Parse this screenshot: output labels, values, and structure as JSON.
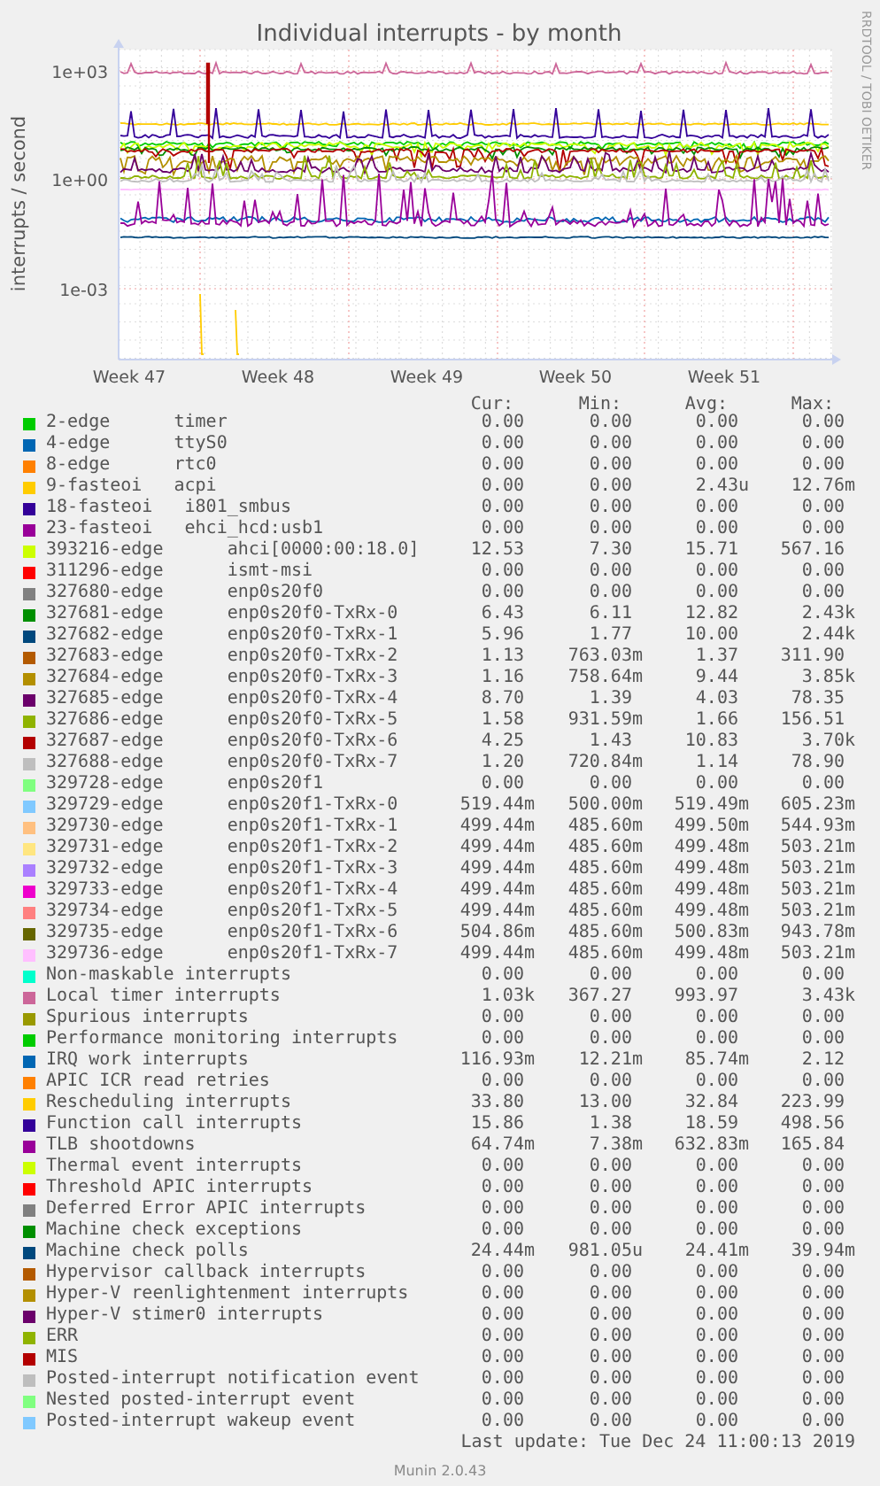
{
  "graph": {
    "title": "Individual interrupts - by month",
    "y_axis_label": "interrupts / second",
    "credit": "RRDTOOL / TOBI OETIKER",
    "y_ticks": [
      "1e+03",
      "1e+00",
      "1e-03"
    ],
    "x_ticks": [
      "Week 47",
      "Week 48",
      "Week 49",
      "Week 50",
      "Week 51"
    ]
  },
  "legend": {
    "columns": [
      "Cur:",
      "Min:",
      "Avg:",
      "Max:"
    ],
    "rows": [
      {
        "label": "2-edge      timer",
        "color": "#00cc00",
        "cur": "0.00",
        "min": "0.00",
        "avg": "0.00",
        "max": "0.00"
      },
      {
        "label": "4-edge      ttyS0",
        "color": "#0066b3",
        "cur": "0.00",
        "min": "0.00",
        "avg": "0.00",
        "max": "0.00"
      },
      {
        "label": "8-edge      rtc0",
        "color": "#ff8000",
        "cur": "0.00",
        "min": "0.00",
        "avg": "0.00",
        "max": "0.00"
      },
      {
        "label": "9-fasteoi   acpi",
        "color": "#ffcc00",
        "cur": "0.00",
        "min": "0.00",
        "avg": "2.43u",
        "max": "12.76m"
      },
      {
        "label": "18-fasteoi   i801_smbus",
        "color": "#330099",
        "cur": "0.00",
        "min": "0.00",
        "avg": "0.00",
        "max": "0.00"
      },
      {
        "label": "23-fasteoi   ehci_hcd:usb1",
        "color": "#990099",
        "cur": "0.00",
        "min": "0.00",
        "avg": "0.00",
        "max": "0.00"
      },
      {
        "label": "393216-edge      ahci[0000:00:18.0]",
        "color": "#ccff00",
        "cur": "12.53",
        "min": "7.30",
        "avg": "15.71",
        "max": "567.16"
      },
      {
        "label": "311296-edge      ismt-msi",
        "color": "#ff0000",
        "cur": "0.00",
        "min": "0.00",
        "avg": "0.00",
        "max": "0.00"
      },
      {
        "label": "327680-edge      enp0s20f0",
        "color": "#808080",
        "cur": "0.00",
        "min": "0.00",
        "avg": "0.00",
        "max": "0.00"
      },
      {
        "label": "327681-edge      enp0s20f0-TxRx-0",
        "color": "#008f00",
        "cur": "6.43",
        "min": "6.11",
        "avg": "12.82",
        "max": "2.43k"
      },
      {
        "label": "327682-edge      enp0s20f0-TxRx-1",
        "color": "#00487d",
        "cur": "5.96",
        "min": "1.77",
        "avg": "10.00",
        "max": "2.44k"
      },
      {
        "label": "327683-edge      enp0s20f0-TxRx-2",
        "color": "#b35a00",
        "cur": "1.13",
        "min": "763.03m",
        "avg": "1.37",
        "max": "311.90"
      },
      {
        "label": "327684-edge      enp0s20f0-TxRx-3",
        "color": "#b38f00",
        "cur": "1.16",
        "min": "758.64m",
        "avg": "9.44",
        "max": "3.85k"
      },
      {
        "label": "327685-edge      enp0s20f0-TxRx-4",
        "color": "#6b006b",
        "cur": "8.70",
        "min": "1.39",
        "avg": "4.03",
        "max": "78.35"
      },
      {
        "label": "327686-edge      enp0s20f0-TxRx-5",
        "color": "#8fb300",
        "cur": "1.58",
        "min": "931.59m",
        "avg": "1.66",
        "max": "156.51"
      },
      {
        "label": "327687-edge      enp0s20f0-TxRx-6",
        "color": "#b30000",
        "cur": "4.25",
        "min": "1.43",
        "avg": "10.83",
        "max": "3.70k"
      },
      {
        "label": "327688-edge      enp0s20f0-TxRx-7",
        "color": "#bebebe",
        "cur": "1.20",
        "min": "720.84m",
        "avg": "1.14",
        "max": "78.90"
      },
      {
        "label": "329728-edge      enp0s20f1",
        "color": "#80ff80",
        "cur": "0.00",
        "min": "0.00",
        "avg": "0.00",
        "max": "0.00"
      },
      {
        "label": "329729-edge      enp0s20f1-TxRx-0",
        "color": "#80c9ff",
        "cur": "519.44m",
        "min": "500.00m",
        "avg": "519.49m",
        "max": "605.23m"
      },
      {
        "label": "329730-edge      enp0s20f1-TxRx-1",
        "color": "#ffc080",
        "cur": "499.44m",
        "min": "485.60m",
        "avg": "499.50m",
        "max": "544.93m"
      },
      {
        "label": "329731-edge      enp0s20f1-TxRx-2",
        "color": "#ffe680",
        "cur": "499.44m",
        "min": "485.60m",
        "avg": "499.48m",
        "max": "503.21m"
      },
      {
        "label": "329732-edge      enp0s20f1-TxRx-3",
        "color": "#aa80ff",
        "cur": "499.44m",
        "min": "485.60m",
        "avg": "499.48m",
        "max": "503.21m"
      },
      {
        "label": "329733-edge      enp0s20f1-TxRx-4",
        "color": "#ee00cc",
        "cur": "499.44m",
        "min": "485.60m",
        "avg": "499.48m",
        "max": "503.21m"
      },
      {
        "label": "329734-edge      enp0s20f1-TxRx-5",
        "color": "#ff8080",
        "cur": "499.44m",
        "min": "485.60m",
        "avg": "499.48m",
        "max": "503.21m"
      },
      {
        "label": "329735-edge      enp0s20f1-TxRx-6",
        "color": "#666600",
        "cur": "504.86m",
        "min": "485.60m",
        "avg": "500.83m",
        "max": "943.78m"
      },
      {
        "label": "329736-edge      enp0s20f1-TxRx-7",
        "color": "#ffbfff",
        "cur": "499.44m",
        "min": "485.60m",
        "avg": "499.48m",
        "max": "503.21m"
      },
      {
        "label": "Non-maskable interrupts",
        "color": "#00ffcc",
        "cur": "0.00",
        "min": "0.00",
        "avg": "0.00",
        "max": "0.00"
      },
      {
        "label": "Local timer interrupts",
        "color": "#cc6699",
        "cur": "1.03k",
        "min": "367.27",
        "avg": "993.97",
        "max": "3.43k"
      },
      {
        "label": "Spurious interrupts",
        "color": "#999900",
        "cur": "0.00",
        "min": "0.00",
        "avg": "0.00",
        "max": "0.00"
      },
      {
        "label": "Performance monitoring interrupts",
        "color": "#00cc00",
        "cur": "0.00",
        "min": "0.00",
        "avg": "0.00",
        "max": "0.00"
      },
      {
        "label": "IRQ work interrupts",
        "color": "#0066b3",
        "cur": "116.93m",
        "min": "12.21m",
        "avg": "85.74m",
        "max": "2.12"
      },
      {
        "label": "APIC ICR read retries",
        "color": "#ff8000",
        "cur": "0.00",
        "min": "0.00",
        "avg": "0.00",
        "max": "0.00"
      },
      {
        "label": "Rescheduling interrupts",
        "color": "#ffcc00",
        "cur": "33.80",
        "min": "13.00",
        "avg": "32.84",
        "max": "223.99"
      },
      {
        "label": "Function call interrupts",
        "color": "#330099",
        "cur": "15.86",
        "min": "1.38",
        "avg": "18.59",
        "max": "498.56"
      },
      {
        "label": "TLB shootdowns",
        "color": "#990099",
        "cur": "64.74m",
        "min": "7.38m",
        "avg": "632.83m",
        "max": "165.84"
      },
      {
        "label": "Thermal event interrupts",
        "color": "#ccff00",
        "cur": "0.00",
        "min": "0.00",
        "avg": "0.00",
        "max": "0.00"
      },
      {
        "label": "Threshold APIC interrupts",
        "color": "#ff0000",
        "cur": "0.00",
        "min": "0.00",
        "avg": "0.00",
        "max": "0.00"
      },
      {
        "label": "Deferred Error APIC interrupts",
        "color": "#808080",
        "cur": "0.00",
        "min": "0.00",
        "avg": "0.00",
        "max": "0.00"
      },
      {
        "label": "Machine check exceptions",
        "color": "#008f00",
        "cur": "0.00",
        "min": "0.00",
        "avg": "0.00",
        "max": "0.00"
      },
      {
        "label": "Machine check polls",
        "color": "#00487d",
        "cur": "24.44m",
        "min": "981.05u",
        "avg": "24.41m",
        "max": "39.94m"
      },
      {
        "label": "Hypervisor callback interrupts",
        "color": "#b35a00",
        "cur": "0.00",
        "min": "0.00",
        "avg": "0.00",
        "max": "0.00"
      },
      {
        "label": "Hyper-V reenlightenment interrupts",
        "color": "#b38f00",
        "cur": "0.00",
        "min": "0.00",
        "avg": "0.00",
        "max": "0.00"
      },
      {
        "label": "Hyper-V stimer0 interrupts",
        "color": "#6b006b",
        "cur": "0.00",
        "min": "0.00",
        "avg": "0.00",
        "max": "0.00"
      },
      {
        "label": "ERR",
        "color": "#8fb300",
        "cur": "0.00",
        "min": "0.00",
        "avg": "0.00",
        "max": "0.00"
      },
      {
        "label": "MIS",
        "color": "#b30000",
        "cur": "0.00",
        "min": "0.00",
        "avg": "0.00",
        "max": "0.00"
      },
      {
        "label": "Posted-interrupt notification event",
        "color": "#bebebe",
        "cur": "0.00",
        "min": "0.00",
        "avg": "0.00",
        "max": "0.00"
      },
      {
        "label": "Nested posted-interrupt event",
        "color": "#80ff80",
        "cur": "0.00",
        "min": "0.00",
        "avg": "0.00",
        "max": "0.00"
      },
      {
        "label": "Posted-interrupt wakeup event",
        "color": "#80c9ff",
        "cur": "0.00",
        "min": "0.00",
        "avg": "0.00",
        "max": "0.00"
      }
    ]
  },
  "last_update": "Last update: Tue Dec 24 11:00:13 2019",
  "footer": "Munin 2.0.43"
}
